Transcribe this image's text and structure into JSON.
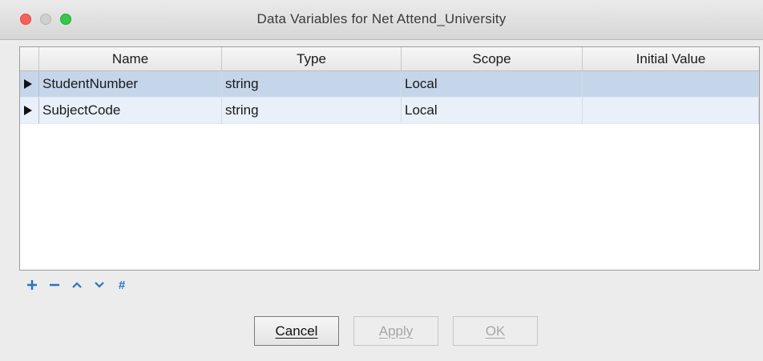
{
  "window": {
    "title": "Data Variables for Net Attend_University"
  },
  "table": {
    "columns": [
      "Name",
      "Type",
      "Scope",
      "Initial Value"
    ],
    "rows": [
      {
        "name": "StudentNumber",
        "type": "string",
        "scope": "Local",
        "initial": "",
        "selected": true
      },
      {
        "name": "SubjectCode",
        "type": "string",
        "scope": "Local",
        "initial": "",
        "selected": false
      }
    ]
  },
  "toolbar": {
    "add": "+",
    "remove": "−",
    "move_up": "⌃",
    "move_down": "⌄",
    "number": "#"
  },
  "buttons": {
    "cancel": "Cancel",
    "apply": "Apply",
    "ok": "OK"
  },
  "colors": {
    "selected_row": "#c5d6ea",
    "alt_row": "#e9f0fa",
    "tool_accent": "#2275c7"
  }
}
